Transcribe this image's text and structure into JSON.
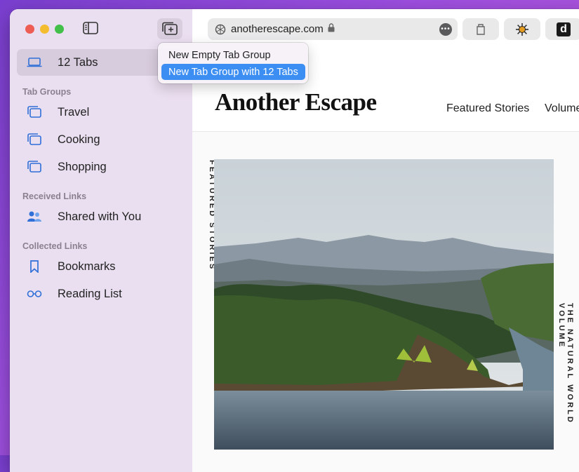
{
  "sidebar": {
    "current_tabs": {
      "label": "12 Tabs",
      "icon": "laptop-icon"
    },
    "sections": [
      {
        "title": "Tab Groups",
        "items": [
          {
            "label": "Travel",
            "icon": "tab-group-icon"
          },
          {
            "label": "Cooking",
            "icon": "tab-group-icon"
          },
          {
            "label": "Shopping",
            "icon": "tab-group-icon"
          }
        ]
      },
      {
        "title": "Received Links",
        "items": [
          {
            "label": "Shared with You",
            "icon": "shared-with-you-icon"
          }
        ]
      },
      {
        "title": "Collected Links",
        "items": [
          {
            "label": "Bookmarks",
            "icon": "bookmark-icon"
          },
          {
            "label": "Reading List",
            "icon": "reading-list-icon"
          }
        ]
      }
    ]
  },
  "toolbar": {
    "url": "anotherescape.com",
    "extensions": [
      "tab-icon",
      "sun-icon",
      "d-icon"
    ],
    "extension_d_label": "d"
  },
  "popover": {
    "items": [
      {
        "label": "New Empty Tab Group",
        "highlighted": false
      },
      {
        "label": "New Tab Group with 12 Tabs",
        "highlighted": true
      }
    ]
  },
  "page": {
    "logo": "Another Escape",
    "nav": [
      "Featured Stories",
      "Volume"
    ],
    "side_label_left": "FEATURED STORIES",
    "side_label_right": "THE NATURAL WORLD VOLUME"
  },
  "colors": {
    "accent": "#3d8ef2",
    "sidebar_bg": "#eadff0",
    "sidebar_icon": "#2f6fd8"
  }
}
